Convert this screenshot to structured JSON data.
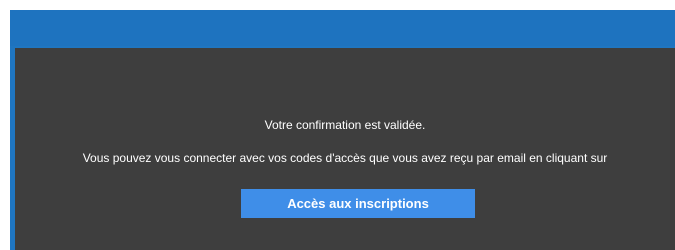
{
  "confirmation": {
    "title": "Votre confirmation est validée.",
    "instructions": "Vous pouvez vous connecter avec vos codes d'accès que vous avez reçu par email en cliquant sur",
    "button_label": "Accès aux inscriptions"
  },
  "colors": {
    "header": "#1e73bf",
    "panel": "#3e3e3e",
    "button": "#3f8ee8",
    "text": "#ffffff"
  }
}
